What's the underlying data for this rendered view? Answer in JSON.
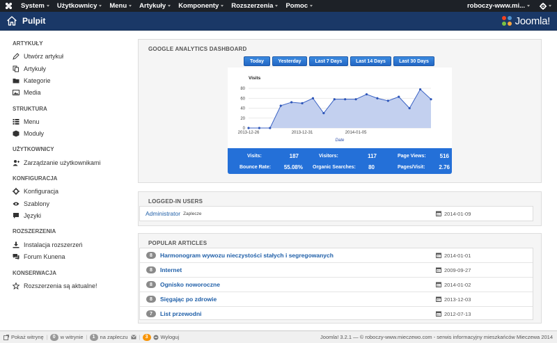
{
  "topbar": {
    "menu": [
      "System",
      "Użytkownicy",
      "Menu",
      "Artykuły",
      "Komponenty",
      "Rozszerzenia",
      "Pomoc"
    ],
    "site": "roboczy-www.mi..."
  },
  "header": {
    "title": "Pulpit",
    "brand": "Joomla!"
  },
  "sidebar": {
    "sections": [
      {
        "heading": "ARTYKUŁY",
        "items": [
          {
            "label": "Utwórz artykuł",
            "icon": "pencil-icon"
          },
          {
            "label": "Artykuły",
            "icon": "copy-icon"
          },
          {
            "label": "Kategorie",
            "icon": "folder-icon"
          },
          {
            "label": "Media",
            "icon": "image-icon"
          }
        ]
      },
      {
        "heading": "STRUKTURA",
        "items": [
          {
            "label": "Menu",
            "icon": "list-icon"
          },
          {
            "label": "Moduły",
            "icon": "cube-icon"
          }
        ]
      },
      {
        "heading": "UŻYTKOWNICY",
        "items": [
          {
            "label": "Zarządzanie użytkownikami",
            "icon": "users-icon"
          }
        ]
      },
      {
        "heading": "KONFIGURACJA",
        "items": [
          {
            "label": "Konfiguracja",
            "icon": "cog-icon"
          },
          {
            "label": "Szablony",
            "icon": "eye-icon"
          },
          {
            "label": "Języki",
            "icon": "comment-icon"
          }
        ]
      },
      {
        "heading": "ROZSZERZENIA",
        "items": [
          {
            "label": "Instalacja rozszerzeń",
            "icon": "download-icon"
          },
          {
            "label": "Forum Kunena",
            "icon": "chat-icon"
          }
        ]
      },
      {
        "heading": "KONSERWACJA",
        "items": [
          {
            "label": "Rozszerzenia są aktualne!",
            "icon": "star-icon"
          }
        ]
      }
    ]
  },
  "analytics": {
    "title": "GOOGLE ANALYTICS DASHBOARD",
    "buttons": [
      "Today",
      "Yesterday",
      "Last 7 Days",
      "Last 14 Days",
      "Last 30 Days"
    ],
    "stats": {
      "visits_label": "Visits:",
      "visits": "187",
      "visitors_label": "Visitors:",
      "visitors": "117",
      "pageviews_label": "Page Views:",
      "pageviews": "516",
      "bounce_label": "Bounce Rate:",
      "bounce": "55.08%",
      "organic_label": "Organic Searches:",
      "organic": "80",
      "ppv_label": "Pages/Visit:",
      "ppv": "2.76"
    }
  },
  "chart_data": {
    "type": "area",
    "title": "Visits",
    "xlabel": "Date",
    "ylabel": "",
    "ylim": [
      0,
      80
    ],
    "yticks": [
      0,
      20,
      40,
      60,
      80
    ],
    "xtick_labels": [
      "2013-12-26",
      "2013-12-31",
      "2014-01-05"
    ],
    "series": [
      {
        "name": "Visits",
        "values": [
          0,
          0,
          0,
          45,
          52,
          50,
          60,
          30,
          58,
          58,
          58,
          68,
          60,
          55,
          63,
          40,
          78,
          58
        ]
      }
    ]
  },
  "logged_in": {
    "title": "LOGGED-IN USERS",
    "rows": [
      {
        "user": "Administrator",
        "context": "Zaplecze",
        "date": "2014-01-09"
      }
    ]
  },
  "popular": {
    "title": "POPULAR ARTICLES",
    "rows": [
      {
        "hits": "8",
        "title": "Harmonogram wywozu nieczystości stałych i segregowanych",
        "date": "2014-01-01"
      },
      {
        "hits": "8",
        "title": "Internet",
        "date": "2009-09-27"
      },
      {
        "hits": "8",
        "title": "Ognisko noworoczne",
        "date": "2014-01-02"
      },
      {
        "hits": "8",
        "title": "Sięgając po zdrowie",
        "date": "2013-12-03"
      },
      {
        "hits": "7",
        "title": "List przewodni",
        "date": "2012-07-13"
      }
    ]
  },
  "footer": {
    "show_site": "Pokaż witrynę",
    "on_site_count": "0",
    "on_site_label": "w witrynie",
    "backend_count": "1",
    "backend_label": "na zapleczu",
    "messages_count": "3",
    "logout": "Wyloguj",
    "copyright": "Joomla! 3.2.1  —  © roboczy-www.mieczewo.com - serwis informacyjny mieszkańców Mieczewa 2014"
  }
}
